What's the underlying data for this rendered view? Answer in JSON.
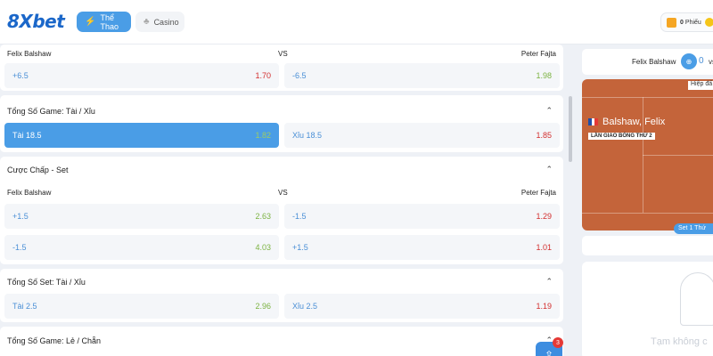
{
  "header": {
    "logo": "8Xbet",
    "tabs": [
      {
        "label": "Thể Thao",
        "active": true,
        "icon": "lightning-icon"
      },
      {
        "label": "Casino",
        "active": false,
        "icon": "club-icon"
      }
    ],
    "ticket": {
      "count": "0",
      "label": "Phiếu"
    }
  },
  "markets": [
    {
      "names": {
        "left": "Felix Balshaw",
        "vs": "VS",
        "right": "Peter Fajta"
      },
      "rows": [
        [
          {
            "label": "+6.5",
            "odd": "1.70",
            "color": "red"
          },
          {
            "label": "-6.5",
            "odd": "1.98",
            "color": "green"
          }
        ]
      ]
    },
    {
      "title": "Tổng Số Game: Tài / Xỉu",
      "rows": [
        [
          {
            "label": "Tài 18.5",
            "odd": "1.82",
            "color": "green",
            "selected": true
          },
          {
            "label": "Xỉu 18.5",
            "odd": "1.85",
            "color": "red"
          }
        ]
      ]
    },
    {
      "title": "Cược Chấp - Set",
      "names": {
        "left": "Felix Balshaw",
        "vs": "VS",
        "right": "Peter Fajta"
      },
      "rows": [
        [
          {
            "label": "+1.5",
            "odd": "2.63",
            "color": "green"
          },
          {
            "label": "-1.5",
            "odd": "1.29",
            "color": "red"
          }
        ],
        [
          {
            "label": "-1.5",
            "odd": "4.03",
            "color": "green"
          },
          {
            "label": "+1.5",
            "odd": "1.01",
            "color": "red"
          }
        ]
      ]
    },
    {
      "title": "Tổng Số Set: Tài / Xỉu",
      "rows": [
        [
          {
            "label": "Tài 2.5",
            "odd": "2.96",
            "color": "green"
          },
          {
            "label": "Xỉu 2.5",
            "odd": "1.19",
            "color": "red"
          }
        ]
      ]
    },
    {
      "title": "Tổng Số Game: Lẻ / Chẵn"
    }
  ],
  "share": {
    "badge": "3"
  },
  "right_panel": {
    "match": {
      "player1": "Felix Balshaw",
      "score": "0",
      "vs": "vs"
    },
    "court": {
      "label": "Hiệp đấ",
      "player": "Balshaw, Felix",
      "tag": "LẦN GIAO BÓNG THỨ 2",
      "set_chip": "Set 1 Thứ"
    },
    "empty_text": "Tạm không c"
  },
  "colors": {
    "accent": "#4a9de6",
    "odd_green": "#7cb342",
    "odd_red": "#d32f2f",
    "court": "#c4643a"
  }
}
